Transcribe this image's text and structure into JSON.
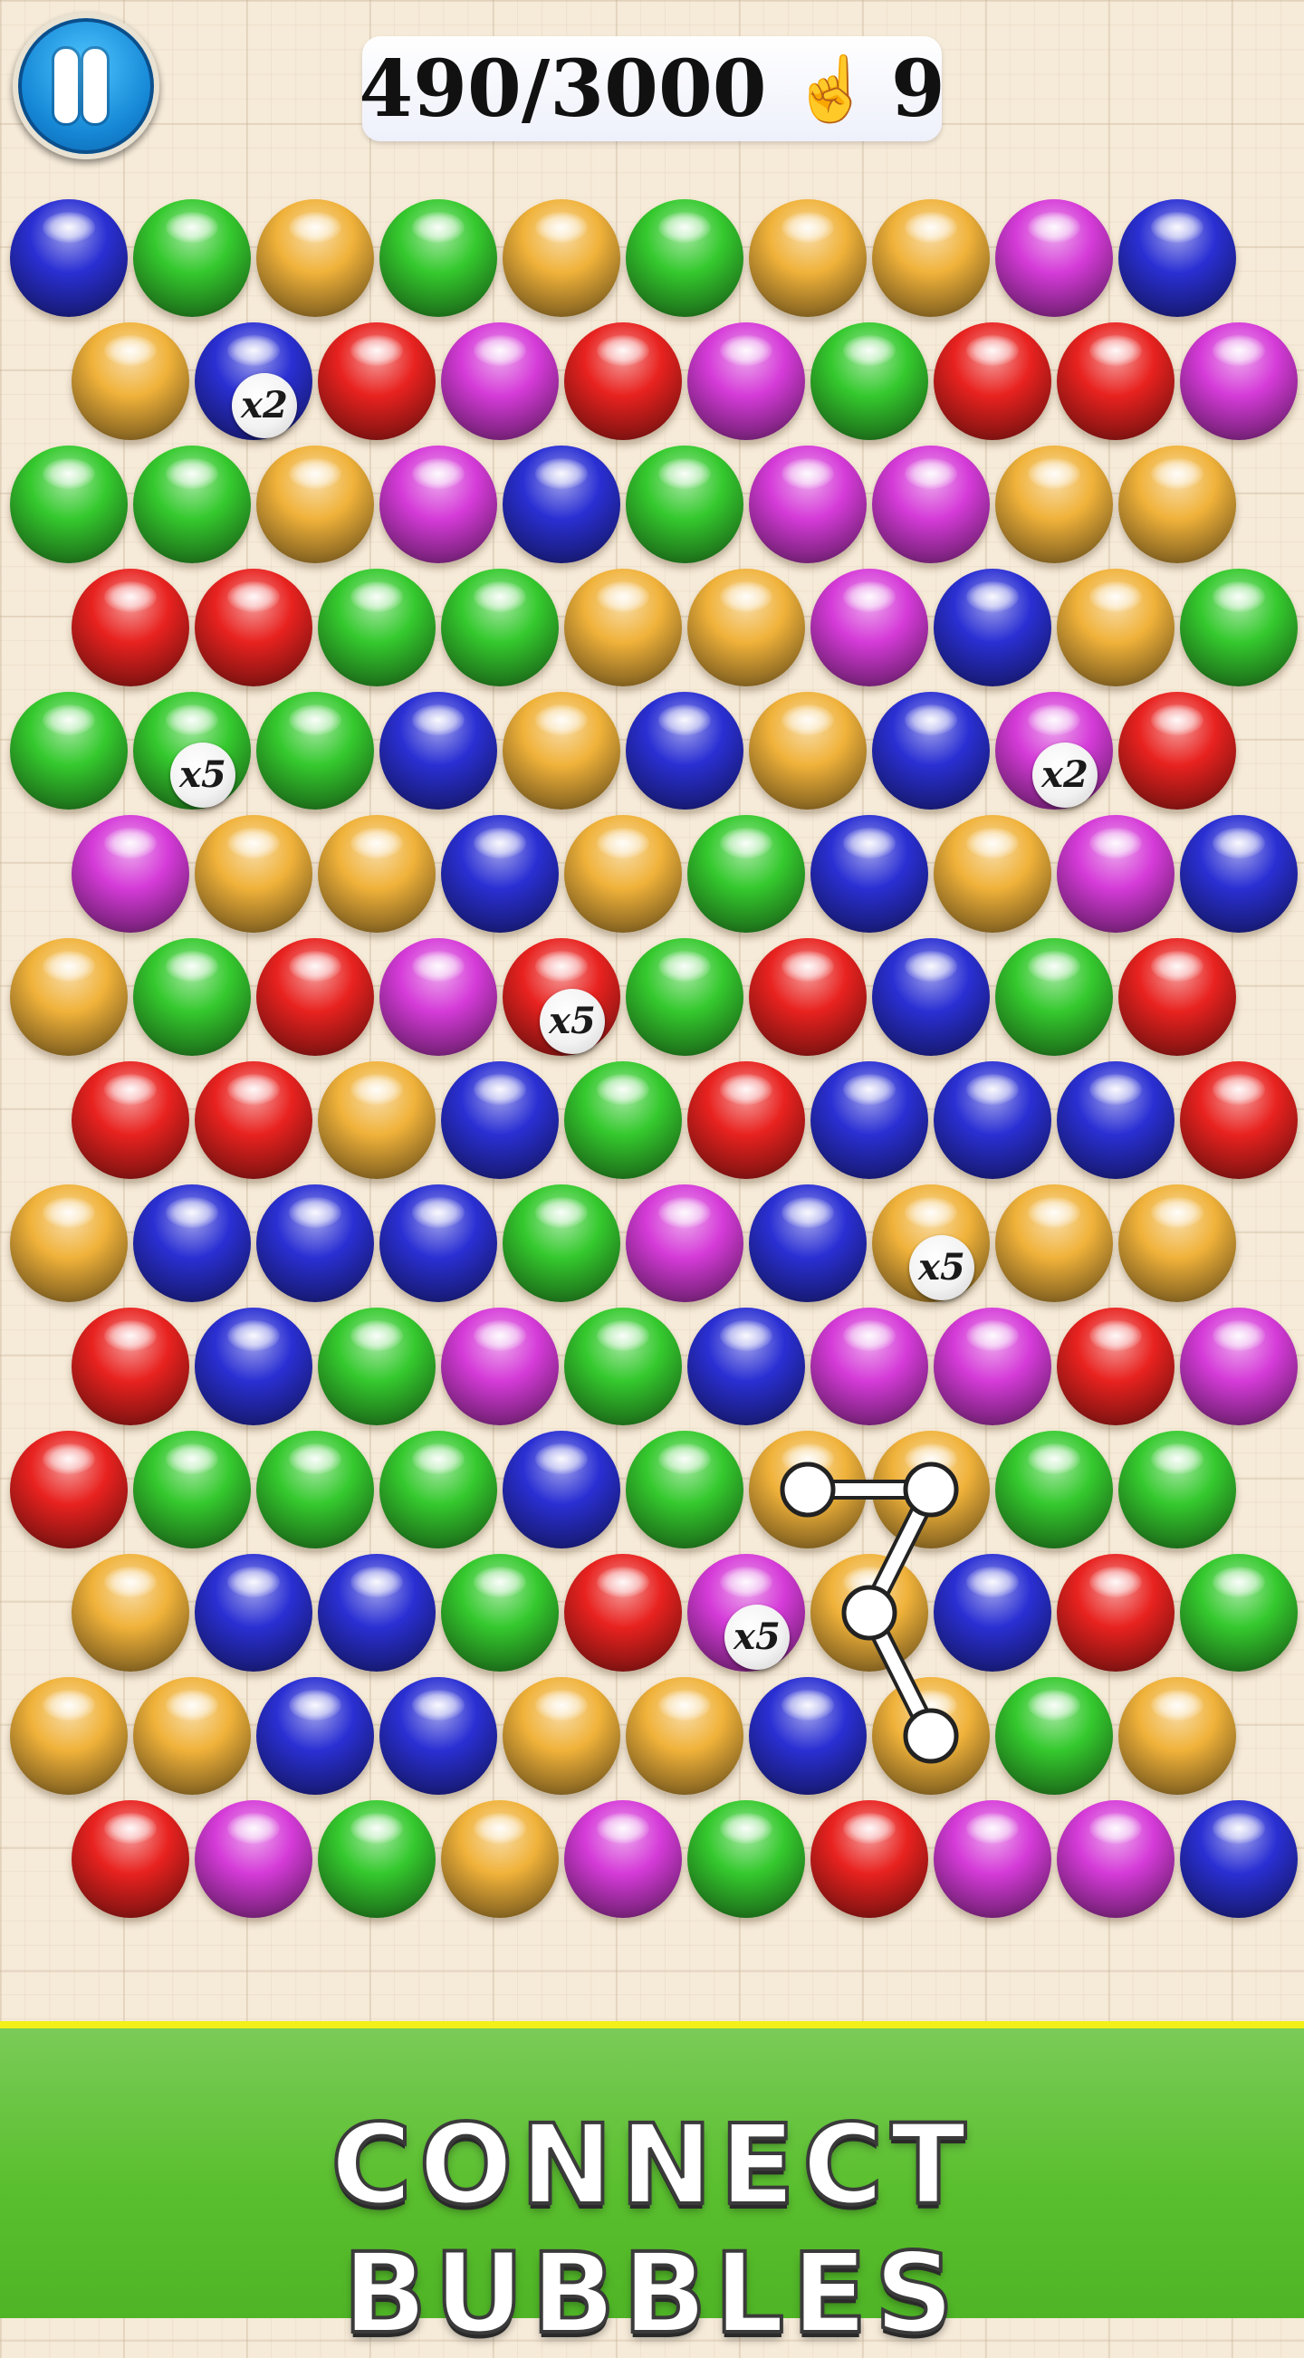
{
  "header": {
    "score": "490/3000",
    "moves_icon": "hand-pointer-icon",
    "moves_left": "9",
    "pause_icon": "pause-icon"
  },
  "banner": {
    "title": "CONNECT BUBBLES"
  },
  "colors": {
    "R": "#e8221f",
    "G": "#35c92e",
    "Y": "#f0b23a",
    "M": "#d53bd8",
    "B": "#2a2fd3"
  },
  "board": {
    "rows": [
      "BGYGYGYYMB",
      "YBRMRMGRRM",
      "GGYMBGMMYY",
      "RRGGYYMBYG",
      "GGGBYBYBMR",
      "MYYBYGBYMB",
      "YGRMRGRBGR",
      "RRYBGRBBBR",
      "YBBBGMBYYY",
      "RBGMGBMMRM",
      "RGGGBGYYGG",
      "YBBGRMYBRG",
      "YYBBYYBYGY",
      "RMGYMGRMMB"
    ],
    "multipliers": [
      {
        "row": 1,
        "col": 1,
        "label": "x2"
      },
      {
        "row": 4,
        "col": 1,
        "label": "x5"
      },
      {
        "row": 4,
        "col": 8,
        "label": "x2"
      },
      {
        "row": 6,
        "col": 4,
        "label": "x5"
      },
      {
        "row": 8,
        "col": 7,
        "label": "x5"
      },
      {
        "row": 11,
        "col": 5,
        "label": "x5"
      }
    ],
    "path": [
      {
        "row": 10,
        "col": 6
      },
      {
        "row": 10,
        "col": 7
      },
      {
        "row": 11,
        "col": 6
      },
      {
        "row": 12,
        "col": 7
      }
    ]
  }
}
